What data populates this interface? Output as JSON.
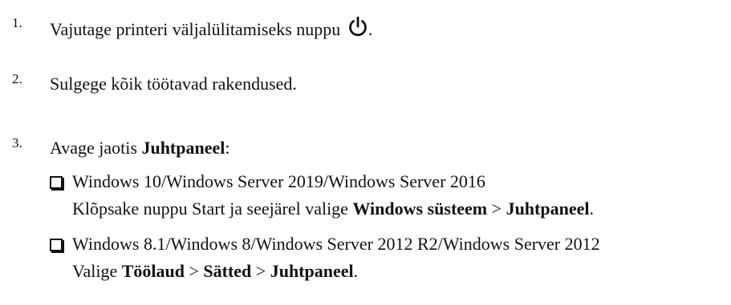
{
  "steps": [
    {
      "number": "1.",
      "text": "Vajutage printeri väljalülitamiseks nuppu",
      "icon": "power-icon",
      "suffix": "."
    },
    {
      "number": "2.",
      "text": "Sulgege kõik töötavad rakendused."
    },
    {
      "number": "3.",
      "text_before": "Avage jaotis ",
      "text_bold": "Juhtpaneel",
      "text_after": ":",
      "options": [
        {
          "title": "Windows 10/Windows Server 2019/Windows Server 2016",
          "detail_plain": "Klõpsake nuppu Start ja seejärel valige ",
          "detail_bold1": "Windows süsteem",
          "detail_sep1": " > ",
          "detail_bold2": "Juhtpaneel",
          "detail_end": "."
        },
        {
          "title": "Windows 8.1/Windows 8/Windows Server 2012 R2/Windows Server 2012",
          "detail_plain": "Valige ",
          "detail_bold1": "Töölaud",
          "detail_sep1": " > ",
          "detail_bold2": "Sätted",
          "detail_sep2": " > ",
          "detail_bold3": "Juhtpaneel",
          "detail_end": "."
        }
      ]
    }
  ]
}
